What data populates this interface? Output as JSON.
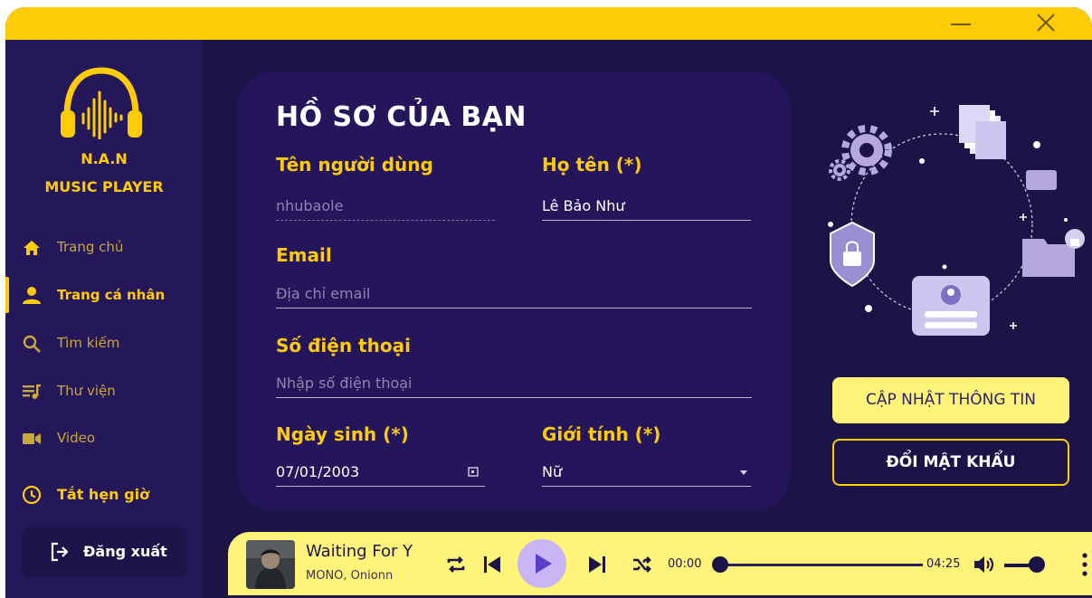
{
  "app": {
    "brand_line1": "N.A.N",
    "brand_line2": "MUSIC PLAYER",
    "accent": "#fecb07",
    "background": "#1c1446"
  },
  "sidebar": {
    "items": [
      {
        "label": "Trang chủ",
        "icon": "home-icon",
        "active": false
      },
      {
        "label": "Trang cá nhân",
        "icon": "person-icon",
        "active": true
      },
      {
        "label": "Tìm kiếm",
        "icon": "search-icon",
        "active": false
      },
      {
        "label": "Thư viện",
        "icon": "library-icon",
        "active": false
      },
      {
        "label": "Video",
        "icon": "video-icon",
        "active": false
      }
    ],
    "timer_label": "Tắt hẹn giờ",
    "logout_label": "Đăng xuất"
  },
  "profile": {
    "title": "HỒ SƠ CỦA BẠN",
    "username_label": "Tên người dùng",
    "username_value": "nhubaole",
    "fullname_label": "Họ tên (*)",
    "fullname_value": "Lê Bảo Như",
    "email_label": "Email",
    "email_placeholder": "Địa chỉ email",
    "phone_label": "Số điện thoại",
    "phone_placeholder": "Nhập số điện thoại",
    "birthday_label": "Ngày sinh (*)",
    "birthday_value": "07/01/2003",
    "gender_label": "Giới tính (*)",
    "gender_value": "Nữ"
  },
  "actions": {
    "update_label": "CẬP NHẬT THÔNG TIN",
    "change_password_label": "ĐỔI MẬT KHẨU"
  },
  "player": {
    "title": "Waiting For Y",
    "artist": "MONO, Onionn",
    "current_time": "00:00",
    "total_time": "04:25",
    "progress": 0,
    "volume": 0.7
  }
}
